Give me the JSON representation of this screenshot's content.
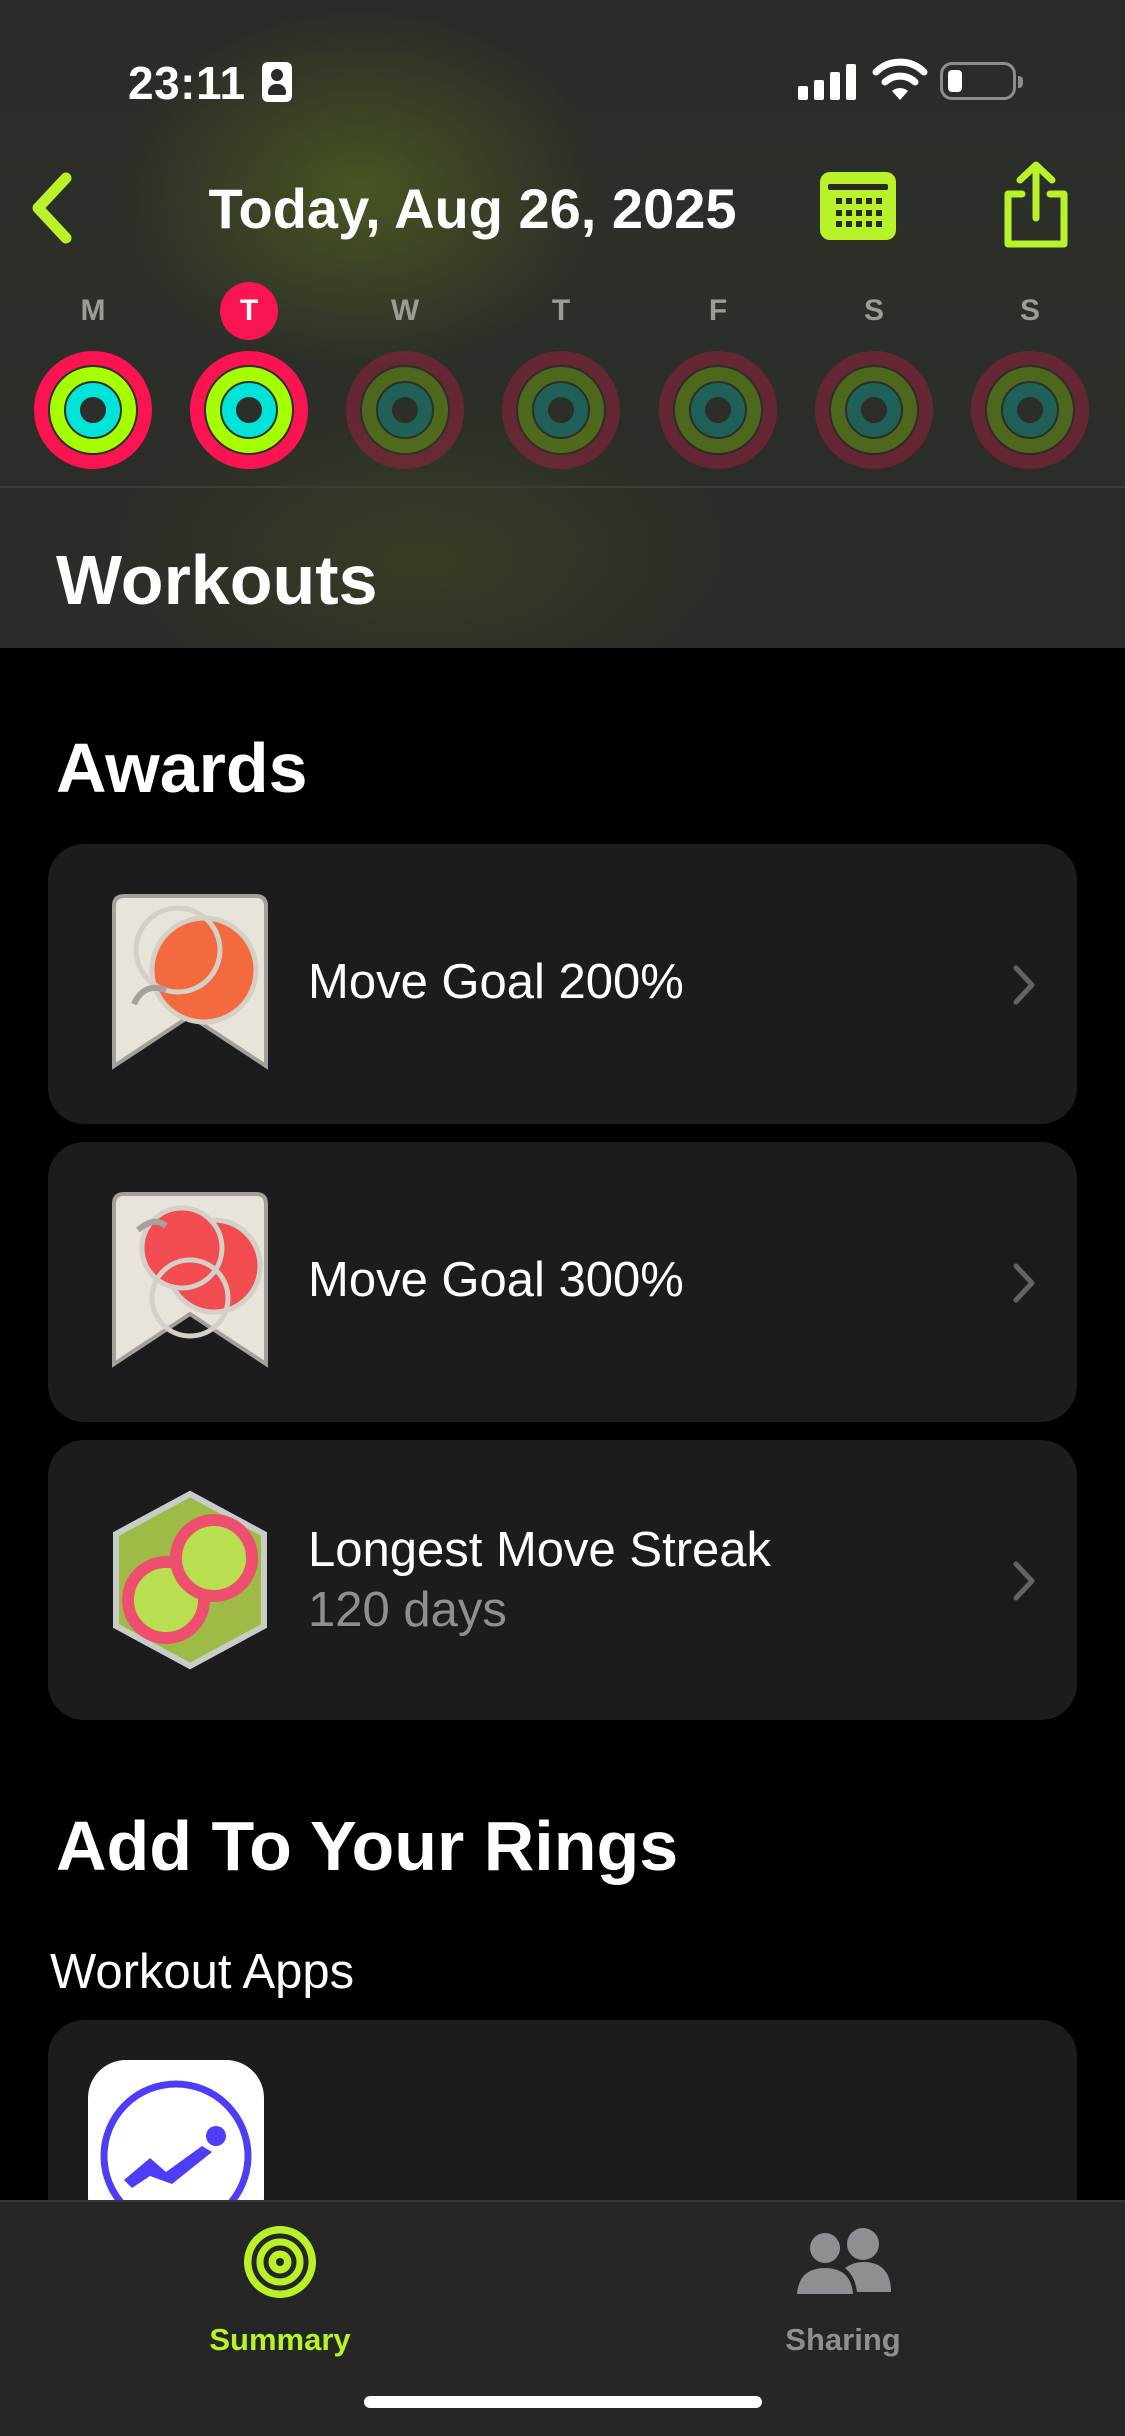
{
  "status_bar": {
    "time": "23:11"
  },
  "nav": {
    "title": "Today, Aug 26, 2025",
    "back_icon": "chevron-left-icon",
    "calendar_icon": "calendar-icon",
    "share_icon": "share-icon",
    "accent_color": "#b8f32a"
  },
  "week": {
    "days": [
      {
        "label": "M",
        "today": false,
        "filled": true
      },
      {
        "label": "T",
        "today": true,
        "filled": true
      },
      {
        "label": "W",
        "today": false,
        "filled": false
      },
      {
        "label": "T",
        "today": false,
        "filled": false
      },
      {
        "label": "F",
        "today": false,
        "filled": false
      },
      {
        "label": "S",
        "today": false,
        "filled": false
      },
      {
        "label": "S",
        "today": false,
        "filled": false
      }
    ],
    "ring_colors": {
      "move": "#fa1452",
      "exercise": "#a6ff00",
      "stand": "#00e3d9"
    }
  },
  "sections": {
    "workouts": "Workouts",
    "awards": "Awards",
    "add_rings": "Add To Your Rings",
    "workout_apps": "Workout Apps"
  },
  "awards": [
    {
      "title": "Move Goal 200%",
      "subtitle": "",
      "icon": "move-goal-200-badge-icon"
    },
    {
      "title": "Move Goal 300%",
      "subtitle": "",
      "icon": "move-goal-300-badge-icon"
    },
    {
      "title": "Longest Move Streak",
      "subtitle": "120 days",
      "icon": "longest-move-streak-badge-icon"
    }
  ],
  "tabbar": {
    "summary": "Summary",
    "sharing": "Sharing",
    "active_color": "#b8f32a",
    "inactive_color": "#8e8e93"
  }
}
